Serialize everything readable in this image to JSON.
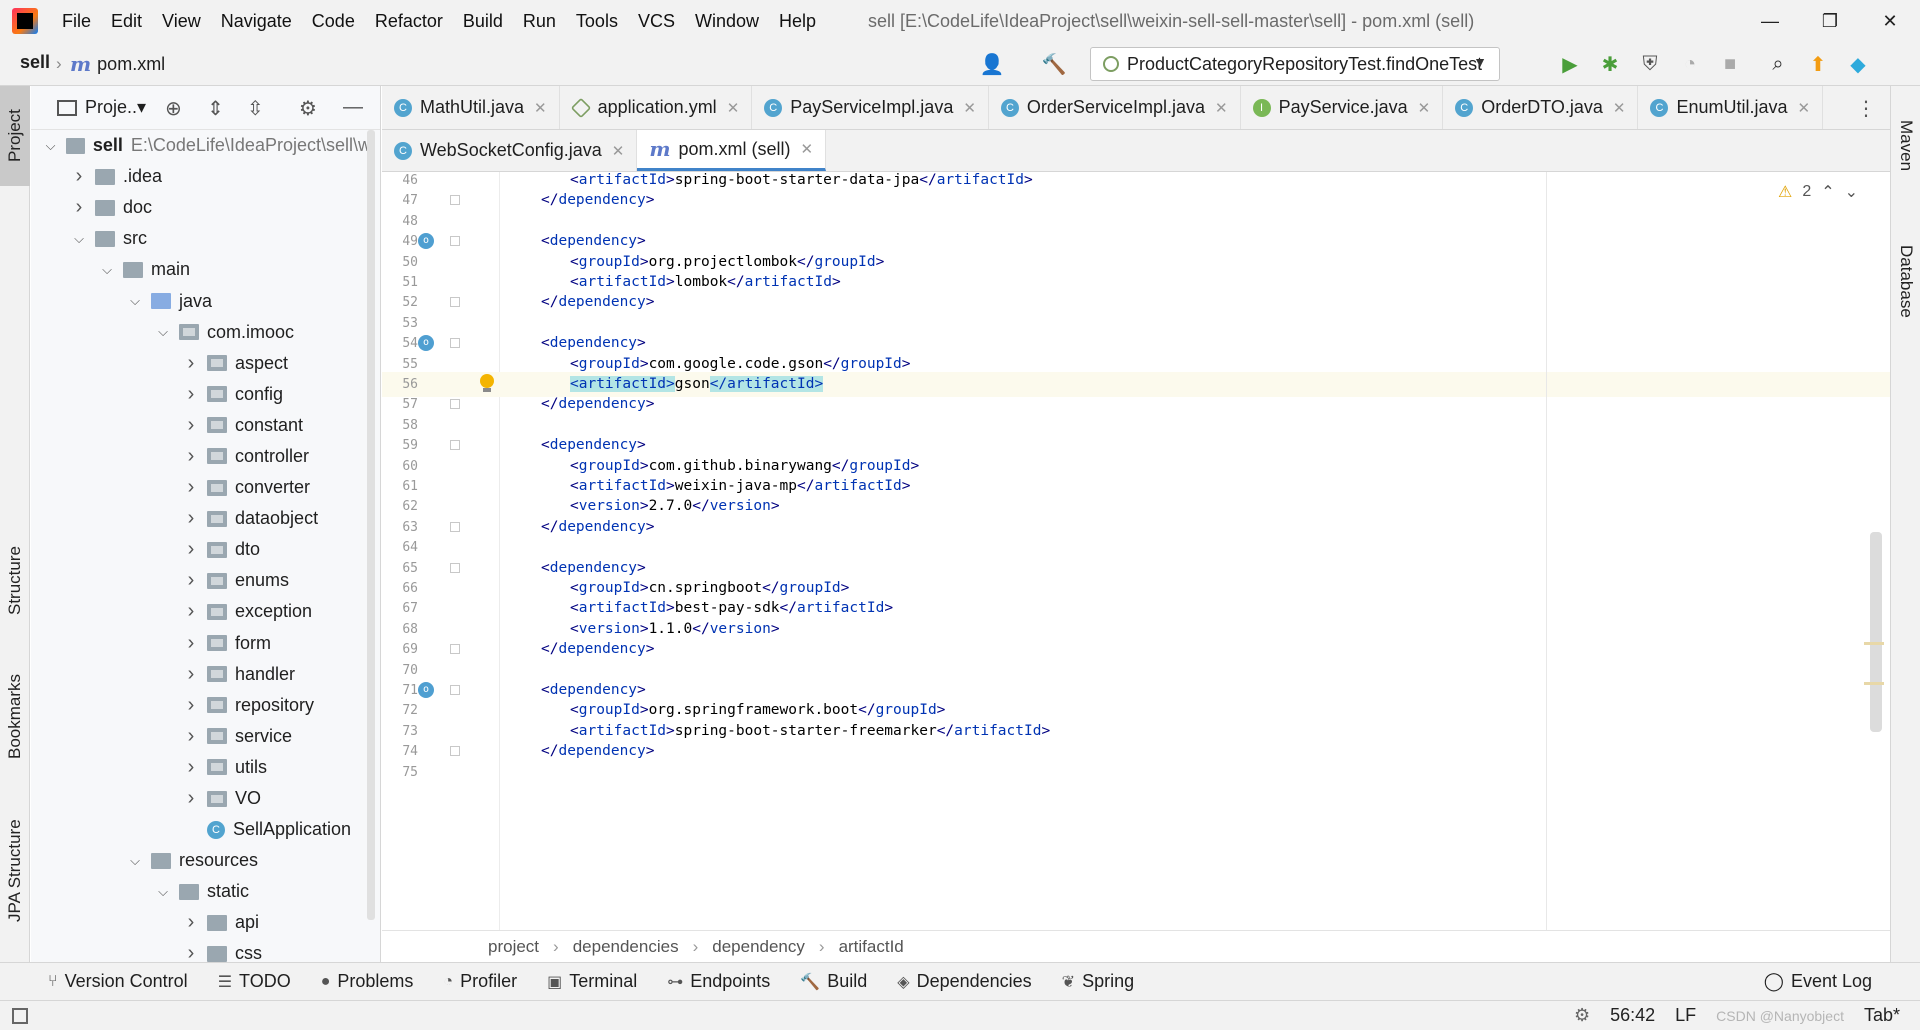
{
  "window": {
    "title": "sell [E:\\CodeLife\\IdeaProject\\sell\\weixin-sell-sell-master\\sell] - pom.xml (sell)",
    "minimize": "—",
    "restore": "❐",
    "close": "✕"
  },
  "menu": [
    "File",
    "Edit",
    "View",
    "Navigate",
    "Code",
    "Refactor",
    "Build",
    "Run",
    "Tools",
    "VCS",
    "Window",
    "Help"
  ],
  "navbar": {
    "project": "sell",
    "file": "pom.xml",
    "run_config": "ProductCategoryRepositoryTest.findOneTest"
  },
  "left_strip": {
    "project": "Project",
    "structure": "Structure",
    "bookmarks": "Bookmarks",
    "jpa": "JPA Structure"
  },
  "right_strip": {
    "maven": "Maven",
    "database": "Database"
  },
  "project_panel": {
    "header": "Proje..▾",
    "tree": [
      {
        "label": "sell",
        "path": "E:\\CodeLife\\IdeaProject\\sell\\w",
        "depth": 0,
        "expanded": true,
        "kind": "module"
      },
      {
        "label": ".idea",
        "depth": 1,
        "expanded": false,
        "kind": "folder"
      },
      {
        "label": "doc",
        "depth": 1,
        "expanded": false,
        "kind": "folder"
      },
      {
        "label": "src",
        "depth": 1,
        "expanded": true,
        "kind": "folder"
      },
      {
        "label": "main",
        "depth": 2,
        "expanded": true,
        "kind": "folder"
      },
      {
        "label": "java",
        "depth": 3,
        "expanded": true,
        "kind": "src"
      },
      {
        "label": "com.imooc",
        "depth": 4,
        "expanded": true,
        "kind": "pkg"
      },
      {
        "label": "aspect",
        "depth": 5,
        "expanded": false,
        "kind": "pkg"
      },
      {
        "label": "config",
        "depth": 5,
        "expanded": false,
        "kind": "pkg"
      },
      {
        "label": "constant",
        "depth": 5,
        "expanded": false,
        "kind": "pkg"
      },
      {
        "label": "controller",
        "depth": 5,
        "expanded": false,
        "kind": "pkg"
      },
      {
        "label": "converter",
        "depth": 5,
        "expanded": false,
        "kind": "pkg"
      },
      {
        "label": "dataobject",
        "depth": 5,
        "expanded": false,
        "kind": "pkg"
      },
      {
        "label": "dto",
        "depth": 5,
        "expanded": false,
        "kind": "pkg"
      },
      {
        "label": "enums",
        "depth": 5,
        "expanded": false,
        "kind": "pkg"
      },
      {
        "label": "exception",
        "depth": 5,
        "expanded": false,
        "kind": "pkg"
      },
      {
        "label": "form",
        "depth": 5,
        "expanded": false,
        "kind": "pkg"
      },
      {
        "label": "handler",
        "depth": 5,
        "expanded": false,
        "kind": "pkg"
      },
      {
        "label": "repository",
        "depth": 5,
        "expanded": false,
        "kind": "pkg"
      },
      {
        "label": "service",
        "depth": 5,
        "expanded": false,
        "kind": "pkg"
      },
      {
        "label": "utils",
        "depth": 5,
        "expanded": false,
        "kind": "pkg"
      },
      {
        "label": "VO",
        "depth": 5,
        "expanded": false,
        "kind": "pkg"
      },
      {
        "label": "SellApplication",
        "depth": 5,
        "expanded": null,
        "kind": "class"
      },
      {
        "label": "resources",
        "depth": 3,
        "expanded": true,
        "kind": "res"
      },
      {
        "label": "static",
        "depth": 4,
        "expanded": true,
        "kind": "folder"
      },
      {
        "label": "api",
        "depth": 5,
        "expanded": false,
        "kind": "folder"
      },
      {
        "label": "css",
        "depth": 5,
        "expanded": false,
        "kind": "folder"
      }
    ]
  },
  "tabs_row1": [
    {
      "label": "MathUtil.java",
      "icon": "C"
    },
    {
      "label": "application.yml",
      "icon": "yml"
    },
    {
      "label": "PayServiceImpl.java",
      "icon": "C"
    },
    {
      "label": "OrderServiceImpl.java",
      "icon": "C"
    },
    {
      "label": "PayService.java",
      "icon": "I"
    },
    {
      "label": "OrderDTO.java",
      "icon": "C"
    },
    {
      "label": "EnumUtil.java",
      "icon": "C"
    }
  ],
  "tabs_row2": [
    {
      "label": "WebSocketConfig.java",
      "icon": "C",
      "active": false
    },
    {
      "label": "pom.xml (sell)",
      "icon": "m",
      "active": true
    }
  ],
  "editor": {
    "inspections": "2",
    "current_line": 56,
    "lines": [
      {
        "n": 46,
        "indent": 2,
        "parts": [
          [
            "tag",
            "<"
          ],
          [
            "name",
            "artifactId"
          ],
          [
            "tag",
            ">"
          ],
          [
            "text",
            "spring-boot-starter-data-jpa"
          ],
          [
            "tag",
            "</"
          ],
          [
            "name",
            "artifactId"
          ],
          [
            "tag",
            ">"
          ]
        ]
      },
      {
        "n": 47,
        "indent": 1,
        "parts": [
          [
            "tag",
            "</"
          ],
          [
            "name",
            "dependency"
          ],
          [
            "tag",
            ">"
          ]
        ]
      },
      {
        "n": 48,
        "indent": 0,
        "parts": []
      },
      {
        "n": 49,
        "indent": 1,
        "gutter": true,
        "parts": [
          [
            "tag",
            "<"
          ],
          [
            "name",
            "dependency"
          ],
          [
            "tag",
            ">"
          ]
        ]
      },
      {
        "n": 50,
        "indent": 2,
        "parts": [
          [
            "tag",
            "<"
          ],
          [
            "name",
            "groupId"
          ],
          [
            "tag",
            ">"
          ],
          [
            "text",
            "org.projectlombok"
          ],
          [
            "tag",
            "</"
          ],
          [
            "name",
            "groupId"
          ],
          [
            "tag",
            ">"
          ]
        ]
      },
      {
        "n": 51,
        "indent": 2,
        "parts": [
          [
            "tag",
            "<"
          ],
          [
            "name",
            "artifactId"
          ],
          [
            "tag",
            ">"
          ],
          [
            "text",
            "lombok"
          ],
          [
            "tag",
            "</"
          ],
          [
            "name",
            "artifactId"
          ],
          [
            "tag",
            ">"
          ]
        ]
      },
      {
        "n": 52,
        "indent": 1,
        "parts": [
          [
            "tag",
            "</"
          ],
          [
            "name",
            "dependency"
          ],
          [
            "tag",
            ">"
          ]
        ]
      },
      {
        "n": 53,
        "indent": 0,
        "parts": []
      },
      {
        "n": 54,
        "indent": 1,
        "gutter": true,
        "parts": [
          [
            "tag",
            "<"
          ],
          [
            "name",
            "dependency"
          ],
          [
            "tag",
            ">"
          ]
        ]
      },
      {
        "n": 55,
        "indent": 2,
        "parts": [
          [
            "tag",
            "<"
          ],
          [
            "name",
            "groupId"
          ],
          [
            "tag",
            ">"
          ],
          [
            "text",
            "com.google.code.gson"
          ],
          [
            "tag",
            "</"
          ],
          [
            "name",
            "groupId"
          ],
          [
            "tag",
            ">"
          ]
        ]
      },
      {
        "n": 56,
        "indent": 2,
        "parts": [
          [
            "htag",
            "<artifactId>"
          ],
          [
            "text",
            "gson"
          ],
          [
            "htag",
            "</artifactId>"
          ]
        ]
      },
      {
        "n": 57,
        "indent": 1,
        "parts": [
          [
            "tag",
            "</"
          ],
          [
            "name",
            "dependency"
          ],
          [
            "tag",
            ">"
          ]
        ]
      },
      {
        "n": 58,
        "indent": 0,
        "parts": []
      },
      {
        "n": 59,
        "indent": 1,
        "parts": [
          [
            "tag",
            "<"
          ],
          [
            "name",
            "dependency"
          ],
          [
            "tag",
            ">"
          ]
        ]
      },
      {
        "n": 60,
        "indent": 2,
        "parts": [
          [
            "tag",
            "<"
          ],
          [
            "name",
            "groupId"
          ],
          [
            "tag",
            ">"
          ],
          [
            "text",
            "com.github.binarywang"
          ],
          [
            "tag",
            "</"
          ],
          [
            "name",
            "groupId"
          ],
          [
            "tag",
            ">"
          ]
        ]
      },
      {
        "n": 61,
        "indent": 2,
        "parts": [
          [
            "tag",
            "<"
          ],
          [
            "name",
            "artifactId"
          ],
          [
            "tag",
            ">"
          ],
          [
            "text",
            "weixin-java-mp"
          ],
          [
            "tag",
            "</"
          ],
          [
            "name",
            "artifactId"
          ],
          [
            "tag",
            ">"
          ]
        ]
      },
      {
        "n": 62,
        "indent": 2,
        "parts": [
          [
            "tag",
            "<"
          ],
          [
            "name",
            "version"
          ],
          [
            "tag",
            ">"
          ],
          [
            "text",
            "2.7.0"
          ],
          [
            "tag",
            "</"
          ],
          [
            "name",
            "version"
          ],
          [
            "tag",
            ">"
          ]
        ]
      },
      {
        "n": 63,
        "indent": 1,
        "parts": [
          [
            "tag",
            "</"
          ],
          [
            "name",
            "dependency"
          ],
          [
            "tag",
            ">"
          ]
        ]
      },
      {
        "n": 64,
        "indent": 0,
        "parts": []
      },
      {
        "n": 65,
        "indent": 1,
        "parts": [
          [
            "tag",
            "<"
          ],
          [
            "name",
            "dependency"
          ],
          [
            "tag",
            ">"
          ]
        ]
      },
      {
        "n": 66,
        "indent": 2,
        "parts": [
          [
            "tag",
            "<"
          ],
          [
            "name",
            "groupId"
          ],
          [
            "tag",
            ">"
          ],
          [
            "text",
            "cn.springboot"
          ],
          [
            "tag",
            "</"
          ],
          [
            "name",
            "groupId"
          ],
          [
            "tag",
            ">"
          ]
        ]
      },
      {
        "n": 67,
        "indent": 2,
        "parts": [
          [
            "tag",
            "<"
          ],
          [
            "name",
            "artifactId"
          ],
          [
            "tag",
            ">"
          ],
          [
            "text",
            "best-pay-sdk"
          ],
          [
            "tag",
            "</"
          ],
          [
            "name",
            "artifactId"
          ],
          [
            "tag",
            ">"
          ]
        ]
      },
      {
        "n": 68,
        "indent": 2,
        "parts": [
          [
            "tag",
            "<"
          ],
          [
            "name",
            "version"
          ],
          [
            "tag",
            ">"
          ],
          [
            "text",
            "1.1.0"
          ],
          [
            "tag",
            "</"
          ],
          [
            "name",
            "version"
          ],
          [
            "tag",
            ">"
          ]
        ]
      },
      {
        "n": 69,
        "indent": 1,
        "parts": [
          [
            "tag",
            "</"
          ],
          [
            "name",
            "dependency"
          ],
          [
            "tag",
            ">"
          ]
        ]
      },
      {
        "n": 70,
        "indent": 0,
        "parts": []
      },
      {
        "n": 71,
        "indent": 1,
        "gutter": true,
        "parts": [
          [
            "tag",
            "<"
          ],
          [
            "name",
            "dependency"
          ],
          [
            "tag",
            ">"
          ]
        ]
      },
      {
        "n": 72,
        "indent": 2,
        "parts": [
          [
            "tag",
            "<"
          ],
          [
            "name",
            "groupId"
          ],
          [
            "tag",
            ">"
          ],
          [
            "text",
            "org.springframework.boot"
          ],
          [
            "tag",
            "</"
          ],
          [
            "name",
            "groupId"
          ],
          [
            "tag",
            ">"
          ]
        ]
      },
      {
        "n": 73,
        "indent": 2,
        "parts": [
          [
            "tag",
            "<"
          ],
          [
            "name",
            "artifactId"
          ],
          [
            "tag",
            ">"
          ],
          [
            "text",
            "spring-boot-starter-freemarker"
          ],
          [
            "tag",
            "</"
          ],
          [
            "name",
            "artifactId"
          ],
          [
            "tag",
            ">"
          ]
        ]
      },
      {
        "n": 74,
        "indent": 1,
        "parts": [
          [
            "tag",
            "</"
          ],
          [
            "name",
            "dependency"
          ],
          [
            "tag",
            ">"
          ]
        ]
      },
      {
        "n": 75,
        "indent": 0,
        "parts": []
      }
    ]
  },
  "breadcrumbs": [
    "project",
    "dependencies",
    "dependency",
    "artifactId"
  ],
  "bottom_tools": [
    "Version Control",
    "TODO",
    "Problems",
    "Profiler",
    "Terminal",
    "Endpoints",
    "Build",
    "Dependencies",
    "Spring"
  ],
  "event_log": "Event Log",
  "status": {
    "position": "56:42",
    "line_sep": "LF",
    "indent": "Tab*",
    "watermark": "CSDN @Nanyobject"
  },
  "colors": {
    "accent": "#4083c9",
    "tag": "#000080",
    "tag_name": "#0033b3",
    "highlight": "#b3e5e5",
    "current_line": "#fcfaed"
  }
}
